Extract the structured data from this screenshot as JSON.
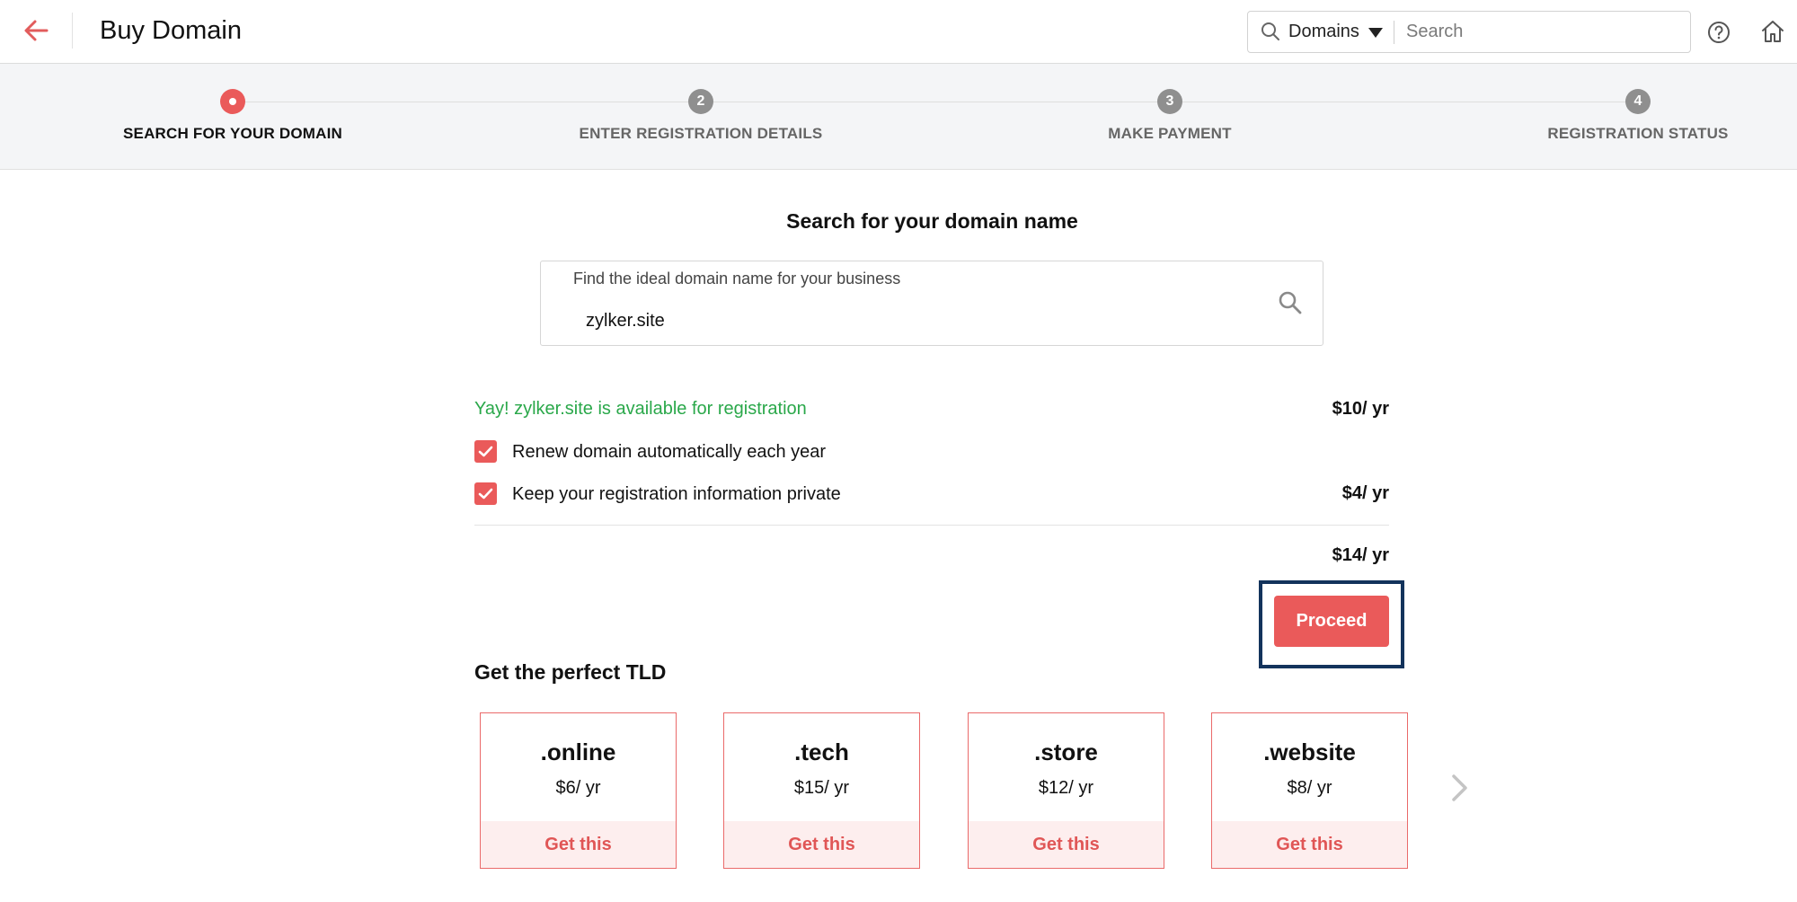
{
  "header": {
    "title": "Buy Domain",
    "search_scope": "Domains",
    "search_placeholder": "Search",
    "icons": {
      "back": "arrow-left-icon",
      "search": "search-icon",
      "help": "help-circle-icon",
      "home": "home-icon"
    }
  },
  "stepper": {
    "steps": [
      {
        "number": "",
        "label": "SEARCH FOR YOUR DOMAIN",
        "active": true
      },
      {
        "number": "2",
        "label": "ENTER REGISTRATION DETAILS",
        "active": false
      },
      {
        "number": "3",
        "label": "MAKE PAYMENT",
        "active": false
      },
      {
        "number": "4",
        "label": "REGISTRATION STATUS",
        "active": false
      }
    ]
  },
  "main": {
    "heading": "Search for your domain name",
    "search_hint": "Find the ideal domain name for your business",
    "search_value": "zylker.site",
    "availability_message": "Yay! zylker.site is available for registration",
    "base_price": "$10/ yr",
    "options": [
      {
        "label": "Renew domain automatically each year",
        "checked": true,
        "price": ""
      },
      {
        "label": "Keep your registration information private",
        "checked": true,
        "price": "$4/ yr"
      }
    ],
    "total_price": "$14/ yr",
    "proceed_label": "Proceed"
  },
  "tld": {
    "heading": "Get the perfect TLD",
    "cards": [
      {
        "name": ".online",
        "price": "$6/ yr",
        "action": "Get this"
      },
      {
        "name": ".tech",
        "price": "$15/ yr",
        "action": "Get this"
      },
      {
        "name": ".store",
        "price": "$12/ yr",
        "action": "Get this"
      },
      {
        "name": ".website",
        "price": "$8/ yr",
        "action": "Get this"
      }
    ]
  },
  "colors": {
    "accent": "#ea5a5a",
    "success": "#2aa84a",
    "highlight_frame": "#13335c",
    "stepper_bg": "#f4f5f7"
  }
}
